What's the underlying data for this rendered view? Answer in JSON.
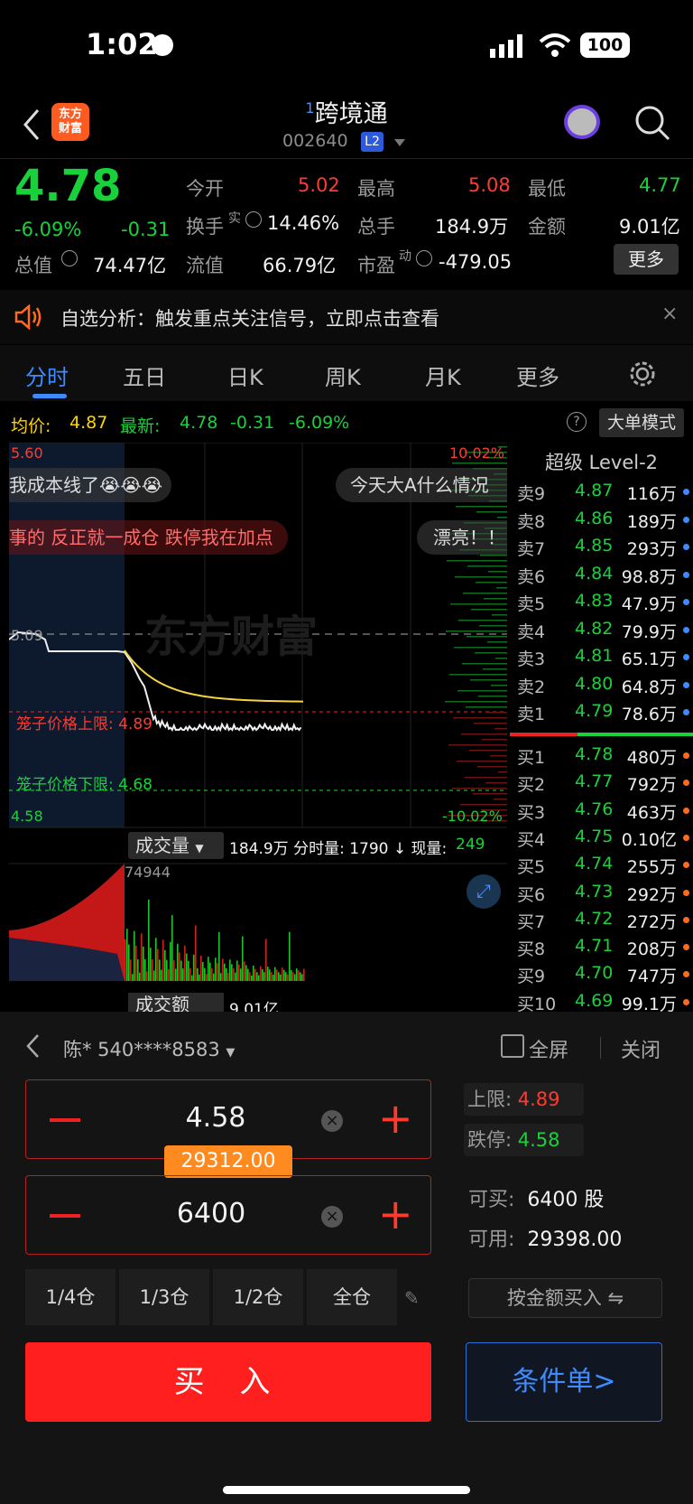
{
  "status_bar": {
    "time": "1:02",
    "battery": "100"
  },
  "header": {
    "logo_line1": "东方",
    "logo_line2": "财富",
    "prefix": "1",
    "name": "跨境通",
    "code": "002640",
    "badge": "L2"
  },
  "quote": {
    "price": "4.78",
    "change_pct": "-6.09%",
    "change": "-0.31",
    "open_label": "今开",
    "open": "5.02",
    "high_label": "最高",
    "high": "5.08",
    "low_label": "最低",
    "low": "4.77",
    "turnover_label": "换手",
    "turnover_sup": "实",
    "turnover": "14.46%",
    "volume_label": "总手",
    "volume": "184.9万",
    "amount_label": "金额",
    "amount": "9.01亿",
    "mcap_label": "总值",
    "mcap": "74.47亿",
    "float_label": "流值",
    "float": "66.79亿",
    "pe_label": "市盈",
    "pe_sup": "动",
    "pe": "-479.05",
    "more": "更多"
  },
  "notice": {
    "text": "自选分析：触发重点关注信号，立即点击查看"
  },
  "tabs": [
    "分时",
    "五日",
    "日K",
    "周K",
    "月K",
    "更多"
  ],
  "chart_header": {
    "avg_label": "均价:",
    "avg": "4.87",
    "latest_label": "最新:",
    "latest": "4.78",
    "chg": "-0.31",
    "pct": "-6.09%",
    "mode": "大单模式"
  },
  "chart": {
    "top_left": "5.60",
    "top_right": "10.02%",
    "bottom_left": "4.58",
    "bottom_right": "-10.02%",
    "prev_close": "5.09",
    "upper_label": "笼子价格上限: 4.89",
    "lower_label": "笼子价格下限: 4.68",
    "danmu": [
      "我成本线了😭😭😭",
      "今天大A什么情况",
      "事的 反正就一成仓 跌停我在加点",
      "漂亮！！"
    ],
    "watermark": "东方财富",
    "vol_select": "成交量",
    "vol_info": "184.9万 分时量: 1790 ↓ 现量:",
    "vol_now": "249",
    "vol_max": "74944",
    "amount_select": "成交额",
    "amount_val": "9.01亿"
  },
  "book": {
    "title": "超级 Level-2",
    "asks": [
      {
        "label": "卖9",
        "price": "4.87",
        "vol": "116万"
      },
      {
        "label": "卖8",
        "price": "4.86",
        "vol": "189万"
      },
      {
        "label": "卖7",
        "price": "4.85",
        "vol": "293万"
      },
      {
        "label": "卖6",
        "price": "4.84",
        "vol": "98.8万"
      },
      {
        "label": "卖5",
        "price": "4.83",
        "vol": "47.9万"
      },
      {
        "label": "卖4",
        "price": "4.82",
        "vol": "79.9万"
      },
      {
        "label": "卖3",
        "price": "4.81",
        "vol": "65.1万"
      },
      {
        "label": "卖2",
        "price": "4.80",
        "vol": "64.8万"
      },
      {
        "label": "卖1",
        "price": "4.79",
        "vol": "78.6万"
      }
    ],
    "bids": [
      {
        "label": "买1",
        "price": "4.78",
        "vol": "480万"
      },
      {
        "label": "买2",
        "price": "4.77",
        "vol": "792万"
      },
      {
        "label": "买3",
        "price": "4.76",
        "vol": "463万"
      },
      {
        "label": "买4",
        "price": "4.75",
        "vol": "0.10亿"
      },
      {
        "label": "买5",
        "price": "4.74",
        "vol": "255万"
      },
      {
        "label": "买6",
        "price": "4.73",
        "vol": "292万"
      },
      {
        "label": "买7",
        "price": "4.72",
        "vol": "272万"
      },
      {
        "label": "买8",
        "price": "4.71",
        "vol": "208万"
      },
      {
        "label": "买9",
        "price": "4.70",
        "vol": "747万"
      },
      {
        "label": "买10",
        "price": "4.69",
        "vol": "99.1万"
      }
    ]
  },
  "trade": {
    "account": "陈* 540****8583",
    "fullscreen": "全屏",
    "close": "关闭",
    "price": "4.58",
    "qty": "6400",
    "amount_tip": "29312.00",
    "upper_label": "上限:",
    "upper": "4.89",
    "limit_down_label": "跌停:",
    "limit_down": "4.58",
    "can_buy_label": "可买:",
    "can_buy": "6400 股",
    "available_label": "可用:",
    "available": "29398.00",
    "positions": [
      "1/4仓",
      "1/3仓",
      "1/2仓",
      "全仓"
    ],
    "by_amount": "按金额买入 ⇋",
    "buy": "买 入",
    "conditional": "条件单>"
  }
}
